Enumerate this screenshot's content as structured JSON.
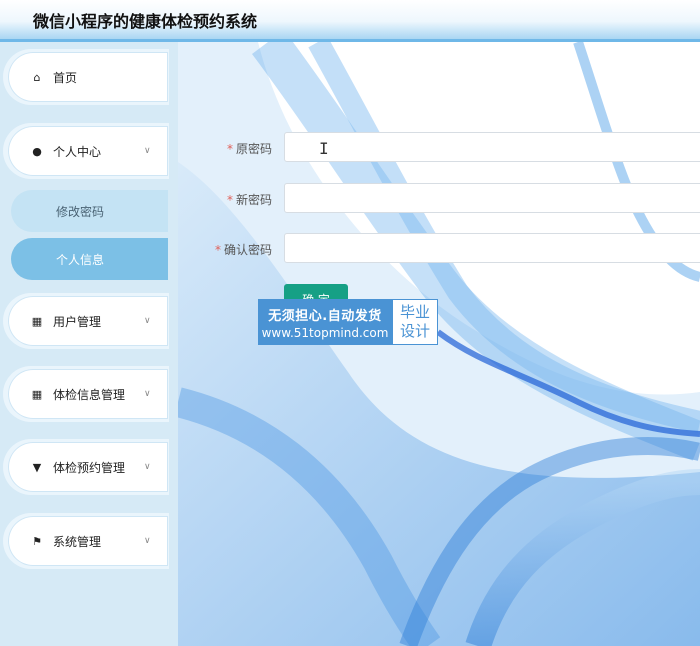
{
  "app": {
    "title": "微信小程序的健康体检预约系统"
  },
  "sidebar": {
    "items": [
      {
        "label": "首页",
        "icon": "home-icon",
        "glyph": "⌂",
        "expandable": false
      },
      {
        "label": "个人中心",
        "icon": "user-icon",
        "glyph": "●",
        "expandable": true
      },
      {
        "label": "用户管理",
        "icon": "grid-icon",
        "glyph": "▦",
        "expandable": true
      },
      {
        "label": "体检信息管理",
        "icon": "apps-icon",
        "glyph": "▦",
        "expandable": true
      },
      {
        "label": "体检预约管理",
        "icon": "pin-icon",
        "glyph": "▼",
        "expandable": true
      },
      {
        "label": "系统管理",
        "icon": "flag-icon",
        "glyph": "⚑",
        "expandable": true
      }
    ],
    "submenu": [
      {
        "label": "修改密码",
        "active": false
      },
      {
        "label": "个人信息",
        "active": true
      }
    ]
  },
  "form": {
    "fields": [
      {
        "label": "原密码",
        "required": true,
        "value": "",
        "placeholder": ""
      },
      {
        "label": "新密码",
        "required": true,
        "value": "",
        "placeholder": ""
      },
      {
        "label": "确认密码",
        "required": true,
        "value": "",
        "placeholder": ""
      }
    ],
    "submit_label": "确 定"
  },
  "watermark": {
    "line1": "无须担心.自动发货",
    "line2": "www.51topmind.com",
    "tag_line1": "毕业",
    "tag_line2": "设计"
  },
  "colors": {
    "accent": "#16a085",
    "active_menu": "#7cc0e6",
    "header_border": "#6fb8e8",
    "required": "#e0605a"
  }
}
